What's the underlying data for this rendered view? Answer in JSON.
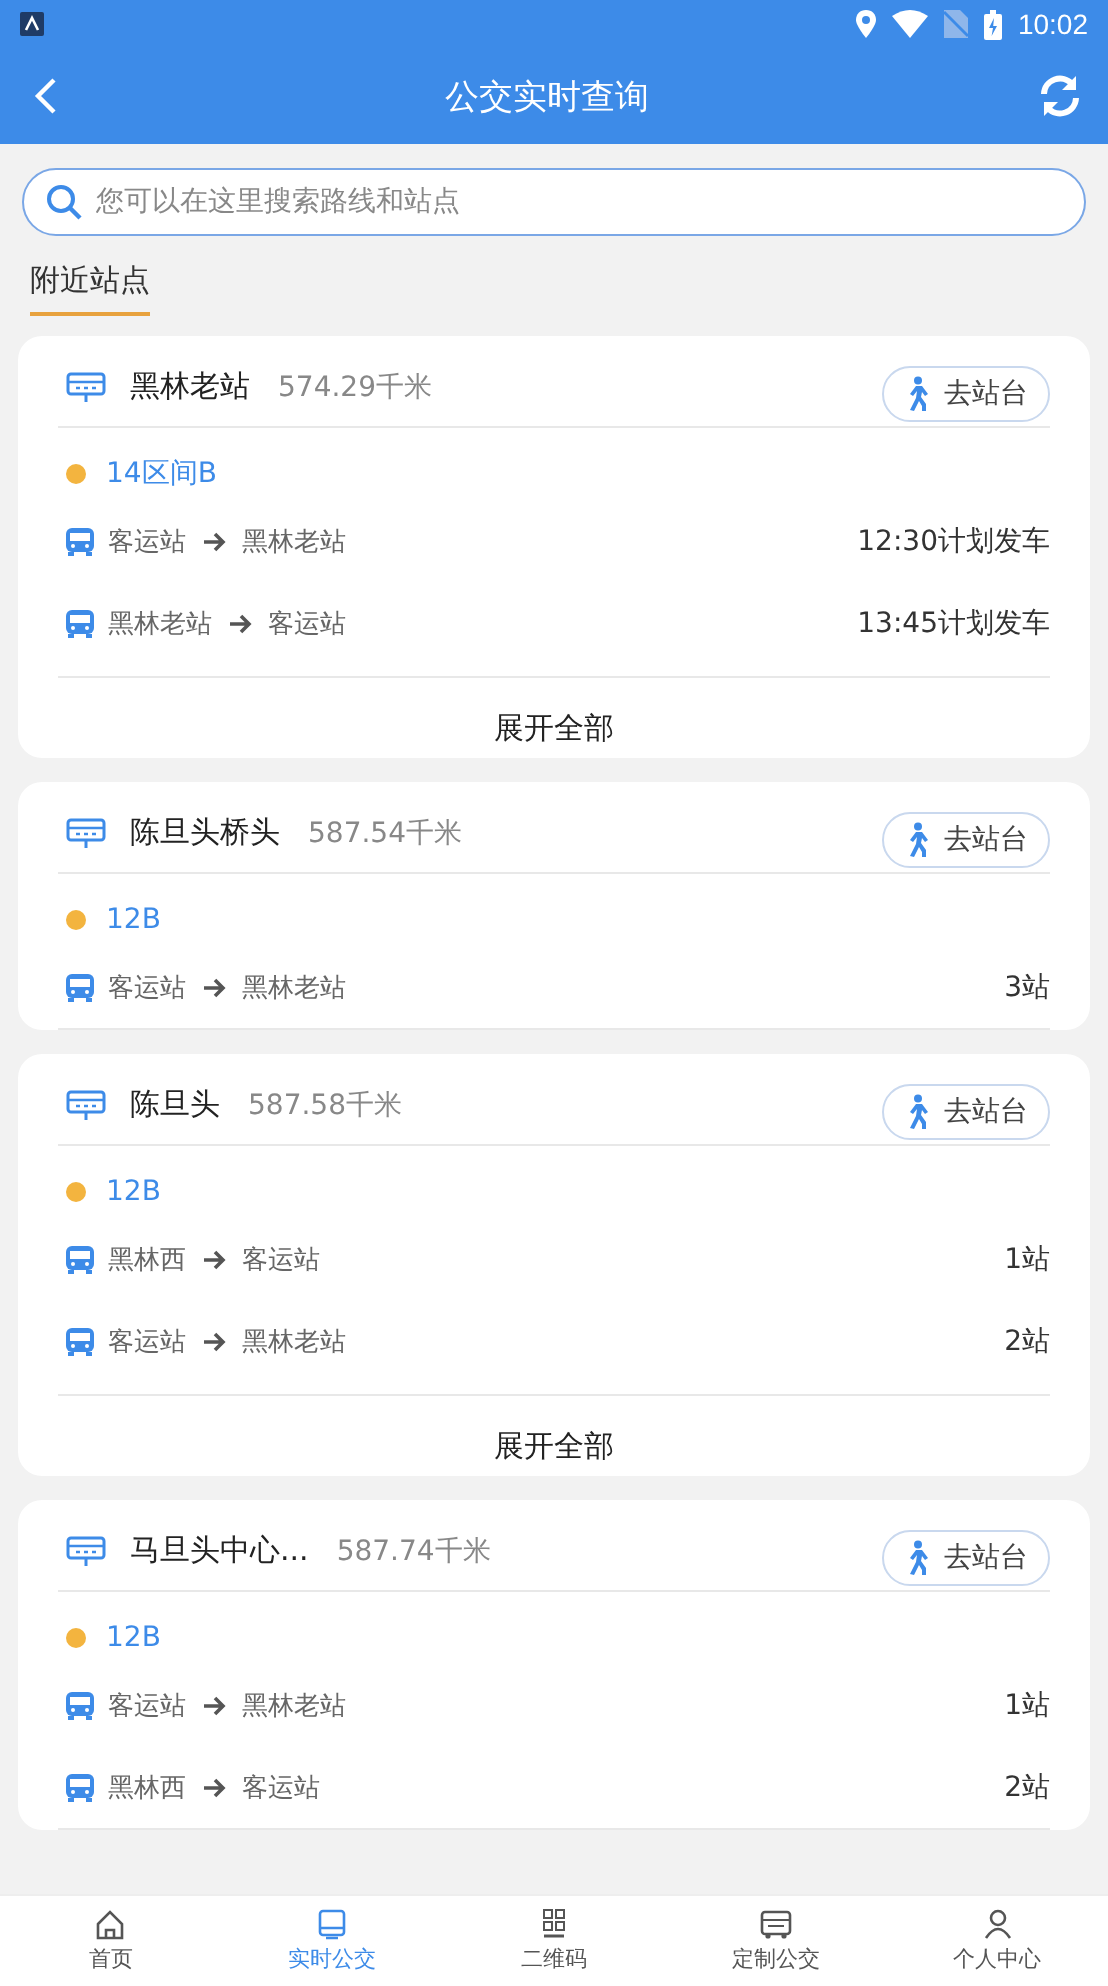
{
  "status_bar": {
    "time": "10:02"
  },
  "header": {
    "title": "公交实时查询"
  },
  "search": {
    "placeholder": "您可以在这里搜索路线和站点"
  },
  "section_tab": {
    "label": "附近站点",
    "selected": true
  },
  "stations": [
    {
      "name": "黑林老站",
      "distance": "574.29千米",
      "button": "去站台",
      "routes": [
        {
          "name": "14区间B",
          "color": "#f3b43f",
          "trips": [
            {
              "from": "客运站",
              "to": "黑林老站",
              "info": "12:30计划发车"
            },
            {
              "from": "黑林老站",
              "to": "客运站",
              "info": "13:45计划发车"
            }
          ]
        }
      ],
      "expand": "展开全部"
    },
    {
      "name": "陈旦头桥头",
      "distance": "587.54千米",
      "button": "去站台",
      "routes": [
        {
          "name": "12B",
          "color": "#f3b43f",
          "trips": [
            {
              "from": "客运站",
              "to": "黑林老站",
              "info": "3站"
            }
          ]
        }
      ]
    },
    {
      "name": "陈旦头",
      "distance": "587.58千米",
      "button": "去站台",
      "routes": [
        {
          "name": "12B",
          "color": "#f3b43f",
          "trips": [
            {
              "from": "黑林西",
              "to": "客运站",
              "info": "1站"
            },
            {
              "from": "客运站",
              "to": "黑林老站",
              "info": "2站"
            }
          ]
        }
      ],
      "expand": "展开全部"
    },
    {
      "name": "马旦头中心...",
      "distance": "587.74千米",
      "button": "去站台",
      "routes": [
        {
          "name": "12B",
          "color": "#f3b43f",
          "trips": [
            {
              "from": "客运站",
              "to": "黑林老站",
              "info": "1站"
            },
            {
              "from": "黑林西",
              "to": "客运站",
              "info": "2站"
            }
          ]
        }
      ]
    }
  ],
  "nav": [
    {
      "label": "首页",
      "kind": "home",
      "selected": false
    },
    {
      "label": "实时公交",
      "kind": "bus",
      "selected": true
    },
    {
      "label": "二维码",
      "kind": "qr",
      "selected": false
    },
    {
      "label": "定制公交",
      "kind": "coach",
      "selected": false
    },
    {
      "label": "个人中心",
      "kind": "person",
      "selected": false
    }
  ]
}
